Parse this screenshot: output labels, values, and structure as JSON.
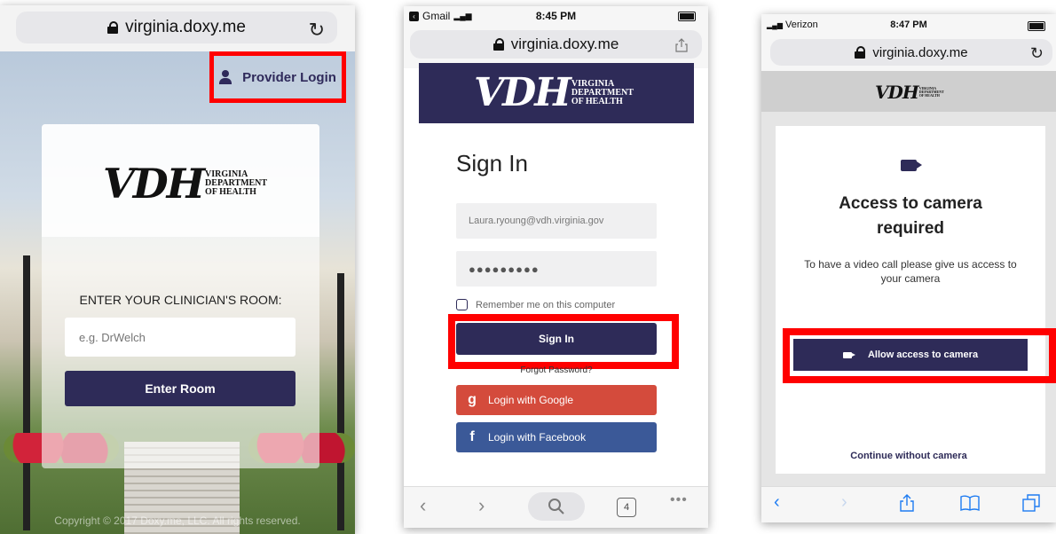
{
  "screen1": {
    "url": "virginia.doxy.me",
    "provider_login": "Provider Login",
    "logo": {
      "letters": "VDH",
      "line1": "VIRGINIA",
      "line2": "DEPARTMENT",
      "line3": "OF HEALTH"
    },
    "room_label": "ENTER YOUR CLINICIAN'S ROOM:",
    "room_placeholder": "e.g. DrWelch",
    "enter_room": "Enter Room",
    "copyright": "Copyright © 2017 Doxy.me, LLC. All rights reserved."
  },
  "screen2": {
    "status": {
      "app": "Gmail",
      "time": "8:45 PM"
    },
    "url": "virginia.doxy.me",
    "logo": {
      "letters": "VDH",
      "line1": "VIRGINIA",
      "line2": "DEPARTMENT",
      "line3": "OF HEALTH"
    },
    "title": "Sign In",
    "email_value": "Laura.ryoung@vdh.virginia.gov",
    "password_mask": "●●●●●●●●●",
    "remember_label": "Remember me on this computer",
    "signin_label": "Sign In",
    "forgot_label": "Forgot Password?",
    "google_label": "Login with Google",
    "facebook_label": "Login with Facebook",
    "google_color": "#d44b3c",
    "facebook_color": "#3b5998",
    "tabs_count": "4"
  },
  "screen3": {
    "status": {
      "carrier": "Verizon",
      "time": "8:47 PM"
    },
    "url": "virginia.doxy.me",
    "logo": {
      "letters": "VDH",
      "line1": "VIRGINIA",
      "line2": "DEPARTMENT",
      "line3": "OF HEALTH"
    },
    "heading_line1": "Access to camera",
    "heading_line2": "required",
    "message": "To have a video call please give us access to your camera",
    "allow_label": "Allow access to camera",
    "continue_label": "Continue without camera"
  },
  "colors": {
    "brand_navy": "#2e2b58",
    "highlight": "#ff0000"
  }
}
